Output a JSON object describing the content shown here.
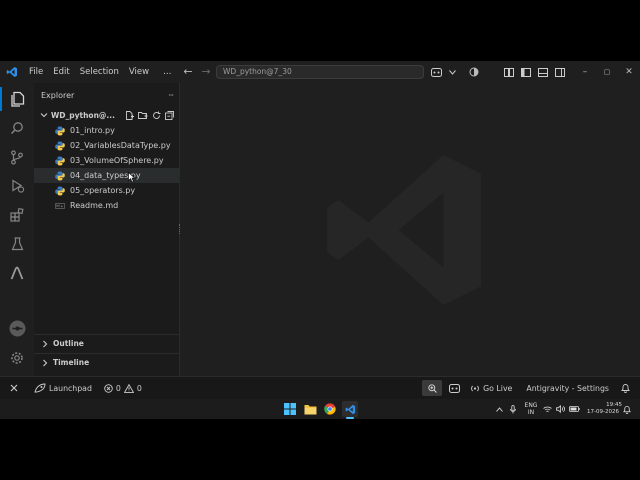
{
  "menu": [
    "File",
    "Edit",
    "Selection",
    "View",
    "…"
  ],
  "nav": {
    "back": "←",
    "forward": "→"
  },
  "command_center": "WD_python@7_30",
  "window_controls": {
    "minimize": "–",
    "restore": "▢",
    "close": "✕"
  },
  "sidebar": {
    "title": "Explorer",
    "more": "···",
    "folder": "WD_python@...",
    "files": [
      {
        "name": "01_intro.py",
        "icon": "python-file-icon"
      },
      {
        "name": "02_VariablesDataType.py",
        "icon": "python-file-icon"
      },
      {
        "name": "03_VolumeOfSphere.py",
        "icon": "python-file-icon"
      },
      {
        "name": "04_data_types.py",
        "icon": "python-file-icon"
      },
      {
        "name": "05_operators.py",
        "icon": "python-file-icon"
      },
      {
        "name": "Readme.md",
        "icon": "markdown-file-icon"
      }
    ],
    "outline": "Outline",
    "timeline": "Timeline"
  },
  "status": {
    "launchpad": "Launchpad",
    "errors": "0",
    "warnings": "0",
    "golive": "Go Live",
    "antigravity": "Antigravity - Settings"
  },
  "taskbar": {
    "lang_top": "ENG",
    "lang_bottom": "IN",
    "time": "19:45",
    "date": "17-09-2026"
  },
  "colors": {
    "background": "#1f1f1f",
    "sidebar": "#1b1b1b",
    "accent": "#0078d4",
    "python_blue": "#3b7bbf",
    "python_yellow": "#f2c94c"
  }
}
